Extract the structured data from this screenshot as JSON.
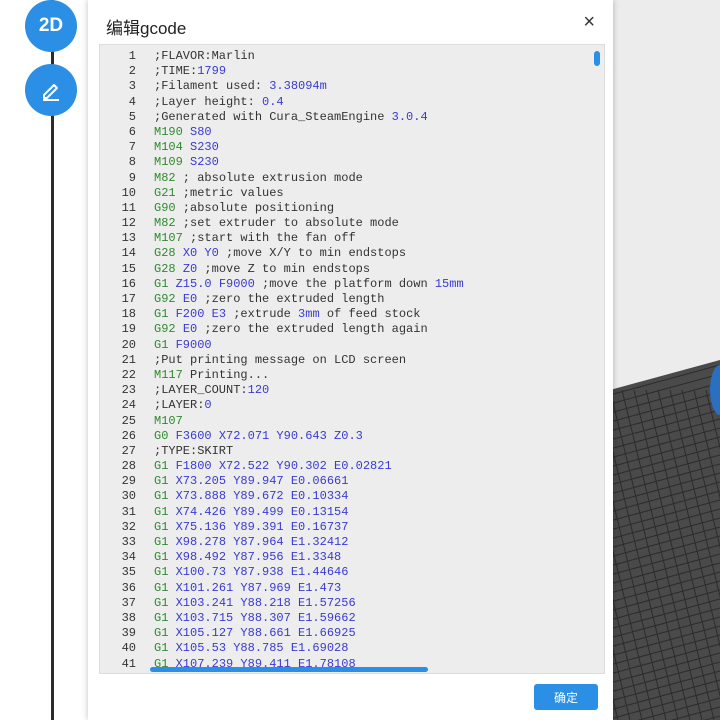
{
  "rail": {
    "btn_2d": "2D",
    "btn_edit_icon": "pencil-icon"
  },
  "dialog": {
    "title": "编辑gcode",
    "close": "×",
    "ok_label": "确定"
  },
  "code_lines": [
    [
      {
        "t": ";FLAVOR:Marlin",
        "c": "default"
      }
    ],
    [
      {
        "t": ";TIME:",
        "c": "default"
      },
      {
        "t": "1799",
        "c": "num"
      }
    ],
    [
      {
        "t": ";Filament used: ",
        "c": "default"
      },
      {
        "t": "3.38094m",
        "c": "num"
      }
    ],
    [
      {
        "t": ";Layer height: ",
        "c": "default"
      },
      {
        "t": "0.4",
        "c": "num"
      }
    ],
    [
      {
        "t": ";Generated with Cura_SteamEngine ",
        "c": "default"
      },
      {
        "t": "3.0.4",
        "c": "num"
      }
    ],
    [
      {
        "t": "M190 ",
        "c": "cmd"
      },
      {
        "t": "S80",
        "c": "num"
      }
    ],
    [
      {
        "t": "M104 ",
        "c": "cmd"
      },
      {
        "t": "S230",
        "c": "num"
      }
    ],
    [
      {
        "t": "M109 ",
        "c": "cmd"
      },
      {
        "t": "S230",
        "c": "num"
      }
    ],
    [
      {
        "t": "M82",
        "c": "cmd"
      },
      {
        "t": " ; absolute extrusion mode",
        "c": "default"
      }
    ],
    [
      {
        "t": "G21",
        "c": "cmd"
      },
      {
        "t": " ;metric values",
        "c": "default"
      }
    ],
    [
      {
        "t": "G90",
        "c": "cmd"
      },
      {
        "t": " ;absolute positioning",
        "c": "default"
      }
    ],
    [
      {
        "t": "M82",
        "c": "cmd"
      },
      {
        "t": " ;set extruder to absolute mode",
        "c": "default"
      }
    ],
    [
      {
        "t": "M107",
        "c": "cmd"
      },
      {
        "t": " ;start with the fan off",
        "c": "default"
      }
    ],
    [
      {
        "t": "G28 ",
        "c": "cmd"
      },
      {
        "t": "X0 Y0",
        "c": "num"
      },
      {
        "t": " ;move X/Y to min endstops",
        "c": "default"
      }
    ],
    [
      {
        "t": "G28 ",
        "c": "cmd"
      },
      {
        "t": "Z0",
        "c": "num"
      },
      {
        "t": " ;move Z to min endstops",
        "c": "default"
      }
    ],
    [
      {
        "t": "G1 ",
        "c": "cmd"
      },
      {
        "t": "Z15.0 F9000",
        "c": "num"
      },
      {
        "t": " ;move the platform down ",
        "c": "default"
      },
      {
        "t": "15mm",
        "c": "num"
      }
    ],
    [
      {
        "t": "G92 ",
        "c": "cmd"
      },
      {
        "t": "E0",
        "c": "num"
      },
      {
        "t": " ;zero the extruded length",
        "c": "default"
      }
    ],
    [
      {
        "t": "G1 ",
        "c": "cmd"
      },
      {
        "t": "F200 E3",
        "c": "num"
      },
      {
        "t": " ;extrude ",
        "c": "default"
      },
      {
        "t": "3mm",
        "c": "num"
      },
      {
        "t": " of feed stock",
        "c": "default"
      }
    ],
    [
      {
        "t": "G92 ",
        "c": "cmd"
      },
      {
        "t": "E0",
        "c": "num"
      },
      {
        "t": " ;zero the extruded length again",
        "c": "default"
      }
    ],
    [
      {
        "t": "G1 ",
        "c": "cmd"
      },
      {
        "t": "F9000",
        "c": "num"
      }
    ],
    [
      {
        "t": ";Put printing message on LCD screen",
        "c": "default"
      }
    ],
    [
      {
        "t": "M117",
        "c": "cmd"
      },
      {
        "t": " Printing...",
        "c": "default"
      }
    ],
    [
      {
        "t": ";LAYER_COUNT:",
        "c": "default"
      },
      {
        "t": "120",
        "c": "num"
      }
    ],
    [
      {
        "t": ";LAYER:",
        "c": "default"
      },
      {
        "t": "0",
        "c": "num"
      }
    ],
    [
      {
        "t": "M107",
        "c": "cmd"
      }
    ],
    [
      {
        "t": "G0 ",
        "c": "cmd"
      },
      {
        "t": "F3600 X72.071 Y90.643 Z0.3",
        "c": "num"
      }
    ],
    [
      {
        "t": ";TYPE:SKIRT",
        "c": "default"
      }
    ],
    [
      {
        "t": "G1 ",
        "c": "cmd"
      },
      {
        "t": "F1800 X72.522 Y90.302 E0.02821",
        "c": "num"
      }
    ],
    [
      {
        "t": "G1 ",
        "c": "cmd"
      },
      {
        "t": "X73.205 Y89.947 E0.06661",
        "c": "num"
      }
    ],
    [
      {
        "t": "G1 ",
        "c": "cmd"
      },
      {
        "t": "X73.888 Y89.672 E0.10334",
        "c": "num"
      }
    ],
    [
      {
        "t": "G1 ",
        "c": "cmd"
      },
      {
        "t": "X74.426 Y89.499 E0.13154",
        "c": "num"
      }
    ],
    [
      {
        "t": "G1 ",
        "c": "cmd"
      },
      {
        "t": "X75.136 Y89.391 E0.16737",
        "c": "num"
      }
    ],
    [
      {
        "t": "G1 ",
        "c": "cmd"
      },
      {
        "t": "X98.278 Y87.964 E1.32412",
        "c": "num"
      }
    ],
    [
      {
        "t": "G1 ",
        "c": "cmd"
      },
      {
        "t": "X98.492 Y87.956 E1.3348",
        "c": "num"
      }
    ],
    [
      {
        "t": "G1 ",
        "c": "cmd"
      },
      {
        "t": "X100.73 Y87.938 E1.44646",
        "c": "num"
      }
    ],
    [
      {
        "t": "G1 ",
        "c": "cmd"
      },
      {
        "t": "X101.261 Y87.969 E1.473",
        "c": "num"
      }
    ],
    [
      {
        "t": "G1 ",
        "c": "cmd"
      },
      {
        "t": "X103.241 Y88.218 E1.57256",
        "c": "num"
      }
    ],
    [
      {
        "t": "G1 ",
        "c": "cmd"
      },
      {
        "t": "X103.715 Y88.307 E1.59662",
        "c": "num"
      }
    ],
    [
      {
        "t": "G1 ",
        "c": "cmd"
      },
      {
        "t": "X105.127 Y88.661 E1.66925",
        "c": "num"
      }
    ],
    [
      {
        "t": "G1 ",
        "c": "cmd"
      },
      {
        "t": "X105.53 Y88.785 E1.69028",
        "c": "num"
      }
    ],
    [
      {
        "t": "G1 ",
        "c": "cmd"
      },
      {
        "t": "X107.239 Y89.411 E1.78108",
        "c": "num"
      }
    ]
  ],
  "colors": {
    "accent": "#2a8fe5",
    "cmd": "#2e8b2e",
    "num": "#3a3ad0",
    "editor_bg": "#ededed"
  }
}
